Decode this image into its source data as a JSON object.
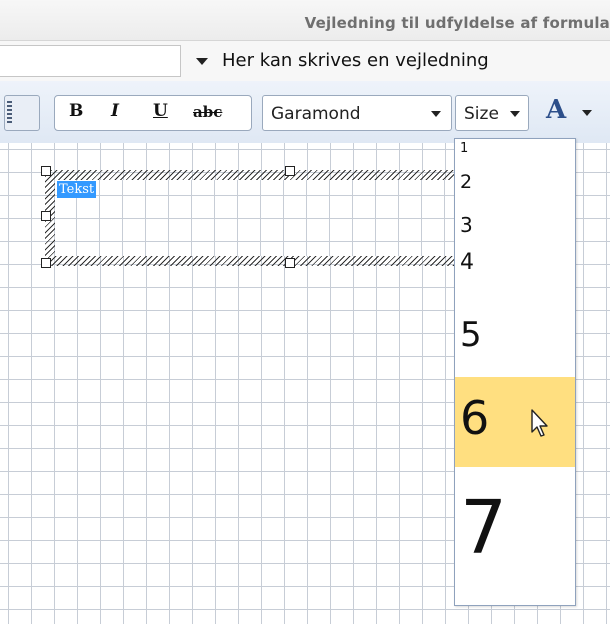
{
  "title": "Vejledning til udfyldelse af formula",
  "field": {
    "guidance_text": "Her kan skrives en vejledning"
  },
  "toolbar": {
    "bold": "B",
    "italic": "I",
    "underline": "U",
    "strike": "abc",
    "font_value": "Garamond",
    "size_value": "Size",
    "color_glyph": "A"
  },
  "textbox": {
    "selected_text": "Tekst"
  },
  "size_dropdown": {
    "items": [
      "1",
      "2",
      "3",
      "4",
      "5",
      "6",
      "7"
    ],
    "highlighted": "6",
    "highlight_color": "#ffdf80"
  },
  "colors": {
    "selection": "#3399ff",
    "toolbar_bg": "#dfe8f4",
    "grid": "#c7cdd6"
  }
}
